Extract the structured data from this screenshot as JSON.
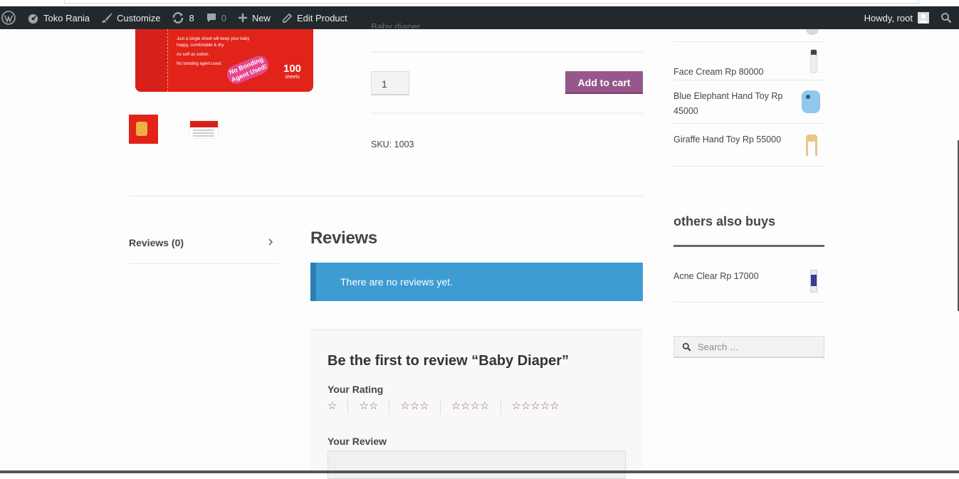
{
  "adminbar": {
    "site_name": "Toko Rania",
    "customize": "Customize",
    "updates_count": "8",
    "comments_count": "0",
    "new": "New",
    "edit_product": "Edit Product",
    "howdy": "Howdy, root"
  },
  "product": {
    "image_bullets": [
      "Just a single sheet will keep your baby happy, comfortable & dry.",
      "As soft as cotton.",
      "No bonding agent used."
    ],
    "image_badge": "No Bonding Agent Used!",
    "image_count": "100",
    "image_count_unit": "sheets",
    "quantity": "1",
    "add_to_cart": "Add to cart",
    "sku_label": "SKU:",
    "sku_value": "1003",
    "summary_partial": "Baby diaper"
  },
  "tabs": [
    {
      "label": "Reviews (0)"
    }
  ],
  "reviews": {
    "title": "Reviews",
    "notice": "There are no reviews yet.",
    "form_title": "Be the first to review “Baby Diaper”",
    "rating_label": "Your Rating",
    "rating_options": [
      "☆",
      "☆☆",
      "☆☆☆",
      "☆☆☆☆",
      "☆☆☆☆☆"
    ],
    "review_label": "Your Review"
  },
  "sidebar": {
    "products": [
      {
        "name": "Face Cream Rp 80000"
      },
      {
        "name": "Blue Elephant Hand Toy Rp 45000"
      },
      {
        "name": "Giraffe Hand Toy Rp 55000"
      }
    ],
    "others_heading": "others also buys",
    "others": [
      {
        "name": "Acne Clear Rp 17000"
      }
    ],
    "search_placeholder": "Search …"
  },
  "colors": {
    "accent": "#96588a",
    "notice_bg": "#3d9cd2",
    "adminbar_bg": "#23282d"
  }
}
